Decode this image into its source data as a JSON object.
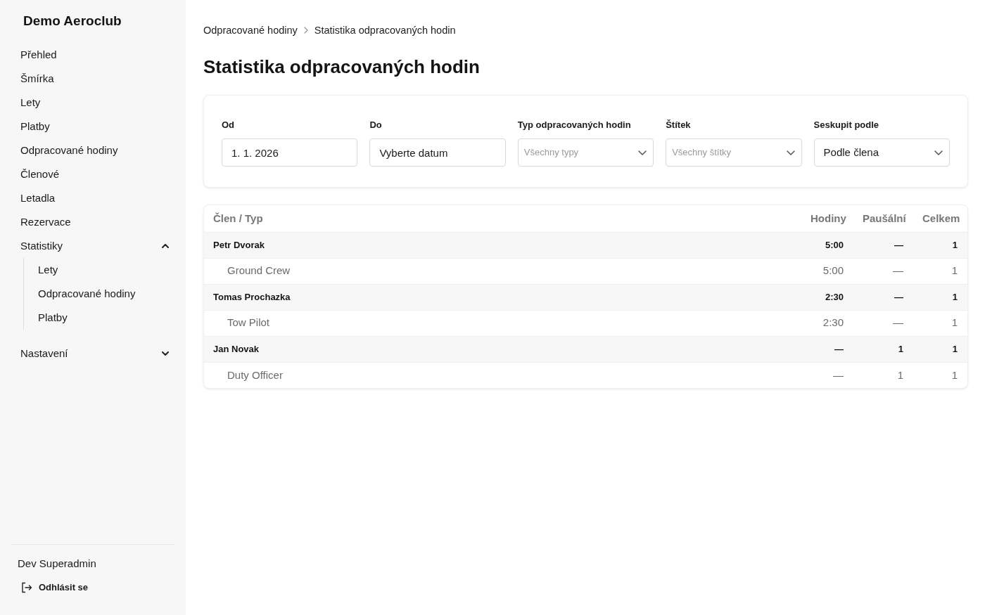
{
  "sidebar": {
    "brand": "Demo Aeroclub",
    "items": [
      {
        "kind": "link",
        "label": "Přehled"
      },
      {
        "kind": "link",
        "label": "Šmírka"
      },
      {
        "kind": "link",
        "label": "Lety"
      },
      {
        "kind": "link",
        "label": "Platby"
      },
      {
        "kind": "link",
        "label": "Odpracované hodiny"
      },
      {
        "kind": "link",
        "label": "Členové"
      },
      {
        "kind": "link",
        "label": "Letadla"
      },
      {
        "kind": "link",
        "label": "Rezervace"
      },
      {
        "kind": "group",
        "label": "Statistiky",
        "expanded": true,
        "children": [
          {
            "label": "Lety"
          },
          {
            "label": "Odpracované hodiny"
          },
          {
            "label": "Platby"
          }
        ]
      },
      {
        "kind": "group",
        "label": "Nastavení",
        "expanded": false
      }
    ],
    "user": "Dev Superadmin",
    "logout": "Odhlásit se"
  },
  "breadcrumb": [
    "Odpracované hodiny",
    "Statistika odpracovaných hodin"
  ],
  "title": "Statistika odpracovaných hodin",
  "filters": [
    {
      "kind": "date",
      "label": "Od",
      "value": "1. 1. 2026"
    },
    {
      "kind": "date",
      "label": "Do",
      "placeholder": "Vyberte datum"
    },
    {
      "kind": "select",
      "label": "Typ odpracovaných hodin",
      "placeholder": "Všechny typy"
    },
    {
      "kind": "select",
      "label": "Štítek",
      "placeholder": "Všechny štítky"
    },
    {
      "kind": "select",
      "label": "Seskupit podle",
      "value": "Podle člena"
    }
  ],
  "table": {
    "columns": [
      "Člen / Typ",
      "Hodiny",
      "Paušální",
      "Celkem"
    ],
    "rows": [
      {
        "cells": [
          "Petr Dvorak",
          "5:00",
          "—",
          "1"
        ],
        "children": [
          {
            "cells": [
              "Ground Crew",
              "5:00",
              "—",
              "1"
            ]
          }
        ]
      },
      {
        "cells": [
          "Tomas Prochazka",
          "2:30",
          "—",
          "1"
        ],
        "children": [
          {
            "cells": [
              "Tow Pilot",
              "2:30",
              "—",
              "1"
            ]
          }
        ]
      },
      {
        "cells": [
          "Jan Novak",
          "—",
          "1",
          "1"
        ],
        "children": [
          {
            "cells": [
              "Duty Officer",
              "—",
              "1",
              "1"
            ]
          }
        ]
      }
    ]
  }
}
